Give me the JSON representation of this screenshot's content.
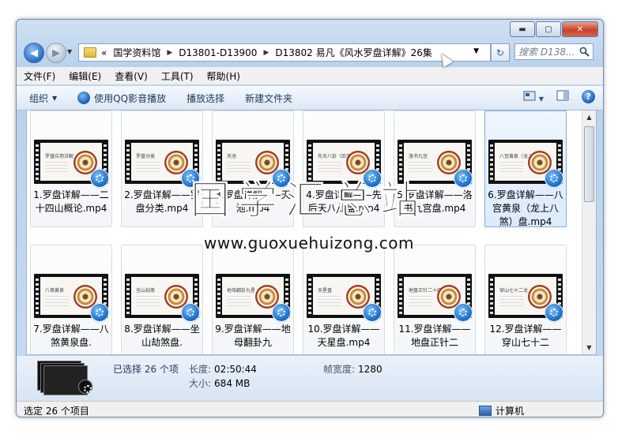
{
  "window": {
    "min": "▬",
    "max": "▢",
    "close": "✕"
  },
  "nav": {
    "back": "◀",
    "forward": "▶",
    "dropdown": "▼"
  },
  "address": {
    "prefix": "«",
    "crumbs": [
      "国学资料馆",
      "D13801-D13900",
      "D13802 易凡《风水罗盘详解》26集"
    ],
    "sep": "▶",
    "drop": "▼"
  },
  "refresh": "↻",
  "search": {
    "placeholder": "搜索 D138...",
    "icon": "search-icon"
  },
  "menu": [
    "文件(F)",
    "编辑(E)",
    "查看(V)",
    "工具(T)",
    "帮助(H)"
  ],
  "toolbar": {
    "organize": "组织",
    "play_qq": "使用QQ影音播放",
    "play_select": "播放选择",
    "new_folder": "新建文件夹",
    "help": "?"
  },
  "scroll": {
    "up": "▲",
    "down": "▼"
  },
  "files": [
    {
      "name": "1.罗盘详解——二十四山概论.mp4",
      "thumb": "罗盘应用详解"
    },
    {
      "name": "2.罗盘详解——罗盘分类.mp4",
      "thumb": "罗盘分类"
    },
    {
      "name": "3.罗盘详解——天池.mp4",
      "thumb": "天池"
    },
    {
      "name": "4.罗盘详解——先后天八卦盘.mp4",
      "thumb": "先天八卦（后天）"
    },
    {
      "name": "5.罗盘详解——洛书九宫盘.mp4",
      "thumb": "洛书九宫"
    },
    {
      "name": "6.罗盘详解——八宫黄泉（龙上八煞）盘.mp4",
      "thumb": "八宫黄泉（龙上八煞）"
    },
    {
      "name": "7.罗盘详解——八煞黄泉盘.",
      "thumb": "八煞黄泉"
    },
    {
      "name": "8.罗盘详解——坐山劫煞盘.",
      "thumb": "坐山劫煞"
    },
    {
      "name": "9.罗盘详解——地母翻卦九",
      "thumb": "地母翻卦九星"
    },
    {
      "name": "10.罗盘详解——天星盘.mp4",
      "thumb": "天星盘"
    },
    {
      "name": "11.罗盘详解——地盘正针二",
      "thumb": "地盘正针二十四山"
    },
    {
      "name": "12.罗盘详解——穿山七十二",
      "thumb": "穿山七十二龙"
    }
  ],
  "details": {
    "selected": "已选择 26 个项",
    "length_label": "长度:",
    "length": "02:50:44",
    "size_label": "大小:",
    "size": "684 MB",
    "width_label": "帧宽度:",
    "width": "1280"
  },
  "status": {
    "left": "选定 26 个项目",
    "right": "计算机"
  },
  "watermark": {
    "cn": "国学汇总站",
    "url": "www.guoxuehuizong.com"
  }
}
